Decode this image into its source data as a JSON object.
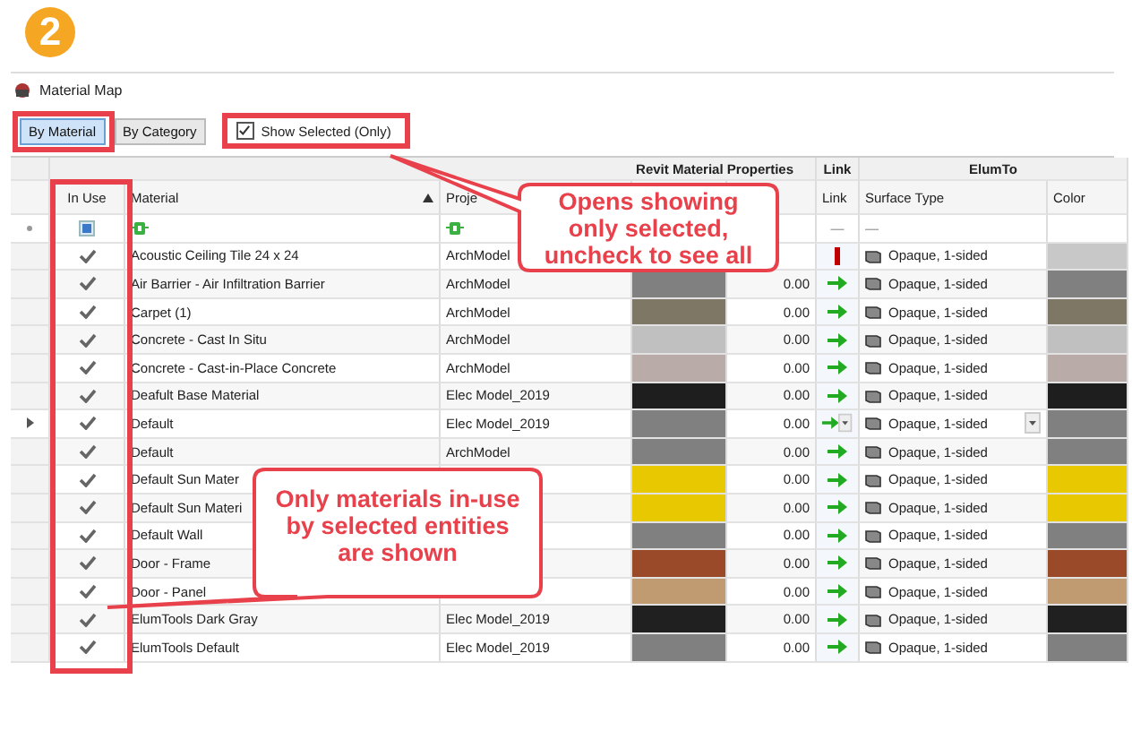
{
  "step_badge": "2",
  "window": {
    "title": "Material Map"
  },
  "view_tabs": [
    {
      "label": "By Material",
      "selected": true
    },
    {
      "label": "By Category",
      "selected": false
    }
  ],
  "show_selected": {
    "label": "Show Selected (Only)",
    "checked": true
  },
  "grid": {
    "bands": [
      {
        "label": "Revit Material Properties"
      },
      {
        "label": "Link"
      },
      {
        "label": "ElumTo"
      }
    ],
    "columns": [
      {
        "label": "In Use"
      },
      {
        "label": "Material",
        "sorted": true
      },
      {
        "label": "Proje"
      },
      {},
      {},
      {
        "label": "Link"
      },
      {
        "label": "Surface Type"
      },
      {
        "label": "Color"
      }
    ],
    "filters": {
      "in_use_checked": true,
      "link": "—",
      "surface": "—"
    },
    "rows": [
      {
        "in_use": true,
        "material": "Acoustic Ceiling Tile 24 x 24",
        "project": "ArchModel",
        "linked": false,
        "surface": "Opaque, 1-sided",
        "elum": {
          "color": "#c8c8c8"
        },
        "current": false
      },
      {
        "in_use": true,
        "material": "Air Barrier - Air Infiltration Barrier",
        "project": "ArchModel",
        "swatch": {
          "color": "#808080"
        },
        "reading": "0.00",
        "linked": true,
        "surface": "Opaque, 1-sided",
        "elum": {
          "color": "#808080"
        },
        "current": false
      },
      {
        "in_use": true,
        "material": "Carpet (1)",
        "project": "ArchModel",
        "swatch": {
          "color": "#7f7766"
        },
        "reading": "0.00",
        "linked": true,
        "surface": "Opaque, 1-sided",
        "elum": {
          "color": "#7f7766"
        },
        "current": false
      },
      {
        "in_use": true,
        "material": "Concrete - Cast In Situ",
        "project": "ArchModel",
        "swatch": {
          "color": "#c0c0c0"
        },
        "reading": "0.00",
        "linked": true,
        "surface": "Opaque, 1-sided",
        "elum": {
          "color": "#c0c0c0"
        },
        "current": false
      },
      {
        "in_use": true,
        "material": "Concrete - Cast-in-Place Concrete",
        "project": "ArchModel",
        "swatch": {
          "color": "#b9aca8"
        },
        "reading": "0.00",
        "linked": true,
        "surface": "Opaque, 1-sided",
        "elum": {
          "color": "#b9aca8"
        },
        "current": false
      },
      {
        "in_use": true,
        "material": "Deafult Base Material",
        "project": "Elec Model_2019",
        "swatch": {
          "color": "#1e1e1e"
        },
        "reading": "0.00",
        "linked": true,
        "surface": "Opaque, 1-sided",
        "elum": {
          "color": "#1e1e1e"
        },
        "current": false
      },
      {
        "in_use": true,
        "material": "Default",
        "project": "Elec Model_2019",
        "swatch": {
          "color": "#808080"
        },
        "reading": "0.00",
        "linked": true,
        "surface": "Opaque, 1-sided",
        "elum": {
          "color": "#808080"
        },
        "current": true
      },
      {
        "in_use": true,
        "material": "Default",
        "project": "ArchModel",
        "swatch": {
          "color": "#808080"
        },
        "reading": "0.00",
        "linked": true,
        "surface": "Opaque, 1-sided",
        "elum": {
          "color": "#808080"
        },
        "current": false
      },
      {
        "in_use": true,
        "material": "Default Sun  Mater",
        "swatch": {
          "color": "#e8c800"
        },
        "reading": "0.00",
        "linked": true,
        "surface": "Opaque, 1-sided",
        "elum": {
          "color": "#e8c800"
        },
        "current": false
      },
      {
        "in_use": true,
        "material": "Default Sun Materi",
        "swatch": {
          "color": "#e8c800"
        },
        "reading": "0.00",
        "linked": true,
        "surface": "Opaque, 1-sided",
        "elum": {
          "color": "#e8c800"
        },
        "current": false
      },
      {
        "in_use": true,
        "material": "Default Wall",
        "swatch": {
          "color": "#808080"
        },
        "reading": "0.00",
        "linked": true,
        "surface": "Opaque, 1-sided",
        "elum": {
          "color": "#808080"
        },
        "current": false
      },
      {
        "in_use": true,
        "material": "Door - Frame",
        "swatch": {
          "color": "#9a4a28"
        },
        "reading": "0.00",
        "linked": true,
        "surface": "Opaque, 1-sided",
        "elum": {
          "color": "#9a4a28"
        },
        "current": false
      },
      {
        "in_use": true,
        "material": "Door - Panel",
        "swatch": {
          "color": "#c09a70"
        },
        "reading": "0.00",
        "linked": true,
        "surface": "Opaque, 1-sided",
        "elum": {
          "color": "#c09a70"
        },
        "current": false
      },
      {
        "in_use": true,
        "material": "ElumTools Dark Gray",
        "project": "Elec Model_2019",
        "swatch": {
          "color": "#202020"
        },
        "reading": "0.00",
        "linked": true,
        "surface": "Opaque, 1-sided",
        "elum": {
          "color": "#202020"
        },
        "current": false
      },
      {
        "in_use": true,
        "material": "ElumTools Default",
        "project": "Elec Model_2019",
        "swatch": {
          "color": "#808080"
        },
        "reading": "0.00",
        "linked": true,
        "surface": "Opaque, 1-sided",
        "elum": {
          "color": "#808080"
        },
        "current": false
      }
    ]
  },
  "callouts": [
    {
      "text": "Opens showing only selected, uncheck to see all"
    },
    {
      "text": "Only materials in-use by selected entities are shown"
    }
  ]
}
